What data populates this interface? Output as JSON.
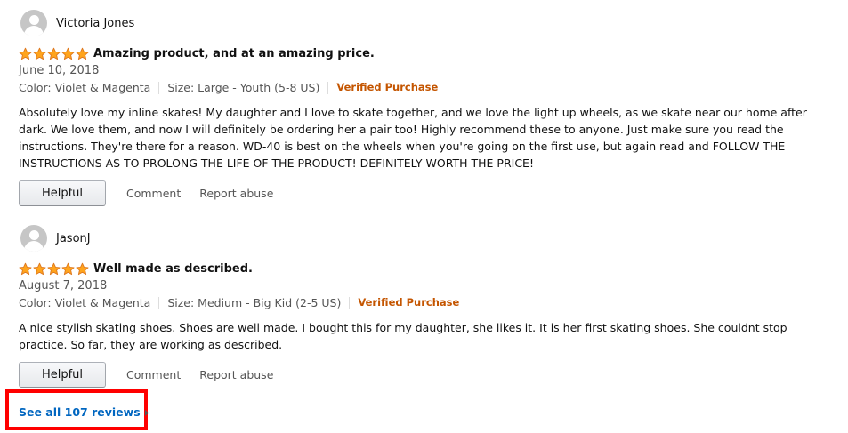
{
  "colors": {
    "star_fill": "#ffa41c",
    "star_stroke": "#de7921",
    "verified": "#c45500",
    "link": "#0066c0",
    "highlight_box": "#ff0000"
  },
  "reviews": [
    {
      "author": "Victoria Jones",
      "rating": 5,
      "title": "Amazing product, and at an amazing price.",
      "date": "June 10, 2018",
      "color": "Color: Violet & Magenta",
      "size": "Size: Large - Youth (5-8 US)",
      "verified": "Verified Purchase",
      "body": "Absolutely love my inline skates! My daughter and I love to skate together, and we love the light up wheels, as we skate near our home after dark. We love them, and now I will definitely be ordering her a pair too! Highly recommend these to anyone. Just make sure you read the instructions. They're there for a reason. WD-40 is best on the wheels when you're going on the first use, but again read and FOLLOW THE INSTRUCTIONS AS TO PROLONG THE LIFE OF THE PRODUCT! DEFINITELY WORTH THE PRICE!",
      "helpful_label": "Helpful",
      "comment_label": "Comment",
      "report_label": "Report abuse"
    },
    {
      "author": "JasonJ",
      "rating": 5,
      "title": "Well made as described.",
      "date": "August 7, 2018",
      "color": "Color: Violet & Magenta",
      "size": "Size: Medium - Big Kid (2-5 US)",
      "verified": "Verified Purchase",
      "body": "A nice stylish skating shoes. Shoes are well made. I bought this for my daughter, she likes it. It is her first skating shoes. She couldnt stop practice. So far, they are working as described.",
      "helpful_label": "Helpful",
      "comment_label": "Comment",
      "report_label": "Report abuse"
    }
  ],
  "see_all": {
    "label": "See all 107 reviews",
    "icon": "chevron-right-icon"
  }
}
